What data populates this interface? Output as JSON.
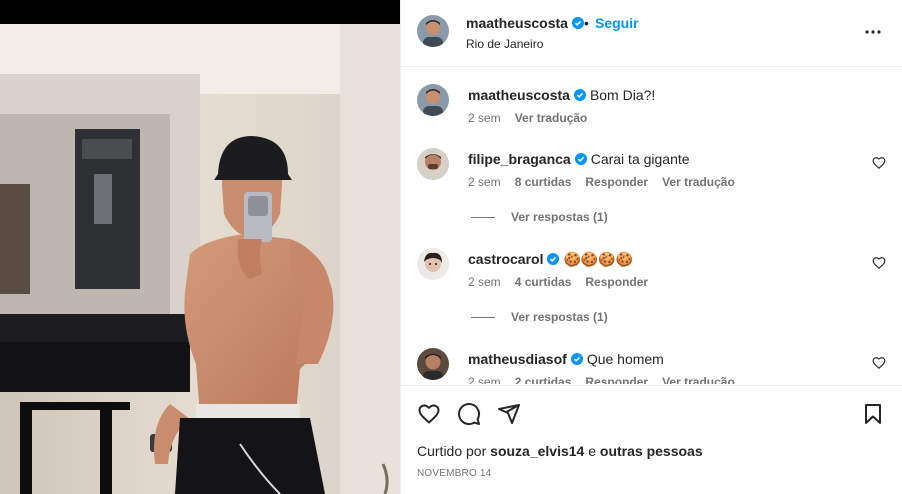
{
  "post": {
    "username": "maatheuscosta",
    "follow_label": "Seguir",
    "separator": "•",
    "location": "Rio de Janeiro"
  },
  "comments": [
    {
      "username": "maatheuscosta",
      "text": "Bom Dia?!",
      "time": "2 sem",
      "likes": "",
      "reply": "",
      "translate": "Ver tradução",
      "replies": ""
    },
    {
      "username": "filipe_braganca",
      "text": "Carai ta gigante",
      "time": "2 sem",
      "likes": "8 curtidas",
      "reply": "Responder",
      "translate": "Ver tradução",
      "replies": "Ver respostas (1)"
    },
    {
      "username": "castrocarol",
      "text": "🍪🍪🍪🍪",
      "time": "2 sem",
      "likes": "4 curtidas",
      "reply": "Responder",
      "translate": "",
      "replies": "Ver respostas (1)"
    },
    {
      "username": "matheusdiasof",
      "text": "Que homem",
      "time": "2 sem",
      "likes": "2 curtidas",
      "reply": "Responder",
      "translate": "Ver tradução",
      "replies": ""
    }
  ],
  "likes": {
    "prefix": "Curtido por",
    "user": "souza_elvis14",
    "connector": "e",
    "others": "outras pessoas"
  },
  "date": "NOVEMBRO 14",
  "icons": {
    "verified": "verified-badge-icon",
    "more": "more-options-icon",
    "like": "heart-icon",
    "comment": "comment-icon",
    "share": "share-icon",
    "save": "bookmark-icon"
  },
  "colors": {
    "accent": "#0095f6",
    "text": "#262626",
    "muted": "#737373",
    "divider": "#efefef"
  }
}
